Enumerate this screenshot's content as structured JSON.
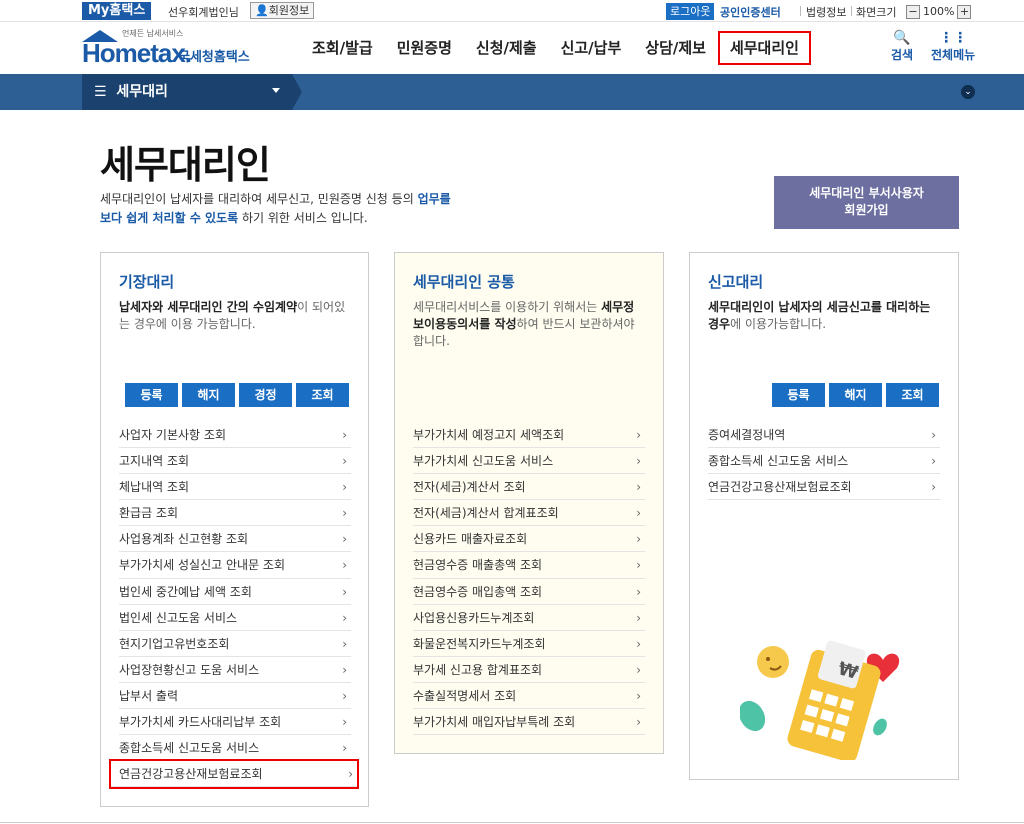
{
  "topbar": {
    "my_hometax": "My홈택스",
    "user": "선우회계법인님",
    "member_info": "회원정보",
    "logout": "로그아웃",
    "cert_center": "공인인증센터",
    "law_info": "법령정보",
    "screen_size": "화면크기",
    "zoom": "100%"
  },
  "header": {
    "logo_small": "언제든 납세서비스",
    "logo_text": "Hometax.",
    "logo_ko": "국세청홈택스",
    "nav": [
      "조회/발급",
      "민원증명",
      "신청/제출",
      "신고/납부",
      "상담/제보",
      "세무대리인"
    ],
    "search": "검색",
    "all_menu": "전체메뉴"
  },
  "subbar": {
    "label": "세무대리"
  },
  "page": {
    "title": "세무대리인",
    "desc_1": "세무대리인이 납세자를 대리하여 세무신고, 민원증명 신청 등의 ",
    "desc_b1": "업무를",
    "desc_b2": "보다 쉽게 처리할 수 있도록",
    "desc_2": " 하기 위한 서비스 입니다.",
    "join_button_1": "세무대리인 부서사용자",
    "join_button_2": "회원가입"
  },
  "cards": {
    "left": {
      "title": "기장대리",
      "desc_b": "납세자와 세무대리인 간의 수임계약",
      "desc": "이 되어있는 경우에 이용 가능합니다.",
      "buttons": [
        "등록",
        "해지",
        "경정",
        "조회"
      ],
      "items": [
        "사업자 기본사항 조회",
        "고지내역 조회",
        "체납내역 조회",
        "환급금 조회",
        "사업용계좌 신고현황 조회",
        "부가가치세 성실신고 안내문 조회",
        "법인세 중간예납 세액 조회",
        "법인세 신고도움 서비스",
        "현지기업고유번호조회",
        "사업장현황신고 도움 서비스",
        "납부서 출력",
        "부가가치세 카드사대리납부 조회",
        "종합소득세 신고도움 서비스",
        "연금건강고용산재보험료조회"
      ]
    },
    "middle": {
      "title": "세무대리인 공통",
      "desc_1": "세무대리서비스를 이용하기 위해서는 ",
      "desc_b": "세무정보이용동의서를 작성",
      "desc_2": "하여 반드시 보관하셔야 합니다.",
      "items": [
        "부가가치세 예정고지 세액조회",
        "부가가치세 신고도움 서비스",
        "전자(세금)계산서 조회",
        "전자(세금)계산서 합계표조회",
        "신용카드 매출자료조회",
        "현금영수증 매출총액 조회",
        "현금영수증 매입총액 조회",
        "사업용신용카드누계조회",
        "화물운전복지카드누계조회",
        "부가세 신고용 합계표조회",
        "수출실적명세서 조회",
        "부가가치세 매입자납부특례 조회"
      ]
    },
    "right": {
      "title": "신고대리",
      "desc_b1": "세무대리인이 납세자의 세금신고를 대리하는 경우",
      "desc": "에 이용가능합니다.",
      "buttons": [
        "등록",
        "해지",
        "조회"
      ],
      "items": [
        "증여세결정내역",
        "종합소득세 신고도움 서비스",
        "연금건강고용산재보험료조회"
      ]
    }
  }
}
